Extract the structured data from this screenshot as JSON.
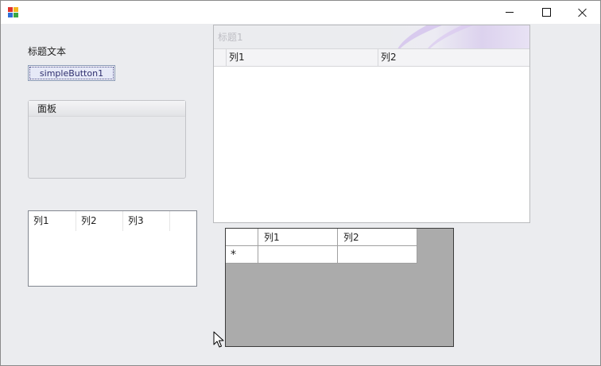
{
  "titlebar": {
    "title": "",
    "icon": "winforms-app-icon",
    "controls": {
      "minimize_icon": "minimize-icon",
      "maximize_icon": "maximize-icon",
      "close_icon": "close-icon"
    }
  },
  "label1": {
    "text": "标题文本"
  },
  "simple_button": {
    "label": "simpleButton1"
  },
  "group_panel": {
    "caption": "面板"
  },
  "list_view": {
    "columns": [
      "列1",
      "列2",
      "列3"
    ]
  },
  "grid_control": {
    "caption": "标题1",
    "columns": [
      "列1",
      "列2"
    ]
  },
  "data_grid_view": {
    "columns": [
      "列1",
      "列2"
    ],
    "new_row_indicator": "*",
    "rows": [
      [
        "",
        ""
      ]
    ]
  },
  "cursor": {
    "icon": "mouse-pointer-icon"
  }
}
